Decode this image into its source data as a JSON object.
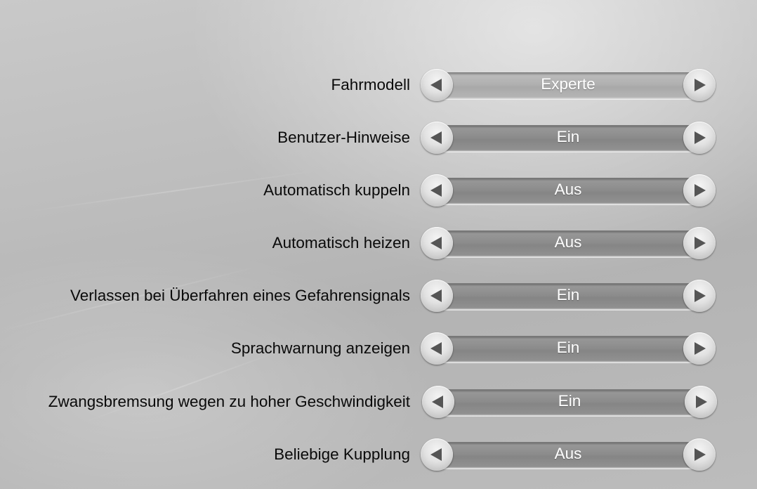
{
  "settings": {
    "rows": [
      {
        "label": "Fahrmodell",
        "value": "Experte",
        "left_icon": "arrow-left-icon",
        "right_icon": "arrow-right-icon",
        "focused": true
      },
      {
        "label": "Benutzer-Hinweise",
        "value": "Ein",
        "left_icon": "arrow-left-icon",
        "right_icon": "arrow-right-icon",
        "focused": false
      },
      {
        "label": "Automatisch kuppeln",
        "value": "Aus",
        "left_icon": "arrow-left-icon",
        "right_icon": "arrow-right-icon",
        "focused": false
      },
      {
        "label": "Automatisch heizen",
        "value": "Aus",
        "left_icon": "arrow-left-icon",
        "right_icon": "arrow-right-icon",
        "focused": false
      },
      {
        "label": "Verlassen bei Überfahren eines Gefahrensignals",
        "value": "Ein",
        "left_icon": "arrow-left-icon",
        "right_icon": "arrow-right-icon",
        "focused": false
      },
      {
        "label": "Sprachwarnung anzeigen",
        "value": "Ein",
        "left_icon": "arrow-left-icon",
        "right_icon": "arrow-right-icon",
        "focused": false
      },
      {
        "label": "Zwangsbremsung wegen zu hoher Geschwindigkeit",
        "value": "Ein",
        "left_icon": "arrow-left-icon",
        "right_icon": "arrow-right-icon",
        "focused": false
      },
      {
        "label": "Beliebige Kupplung",
        "value": "Aus",
        "left_icon": "arrow-left-icon",
        "right_icon": "arrow-right-icon",
        "focused": false
      }
    ]
  },
  "colors": {
    "label_text": "#0a0a0a",
    "value_text": "#ffffff",
    "track": "#8c8c8c",
    "track_focused": "#b0b0b0",
    "arrow_glyph": "#555555"
  }
}
